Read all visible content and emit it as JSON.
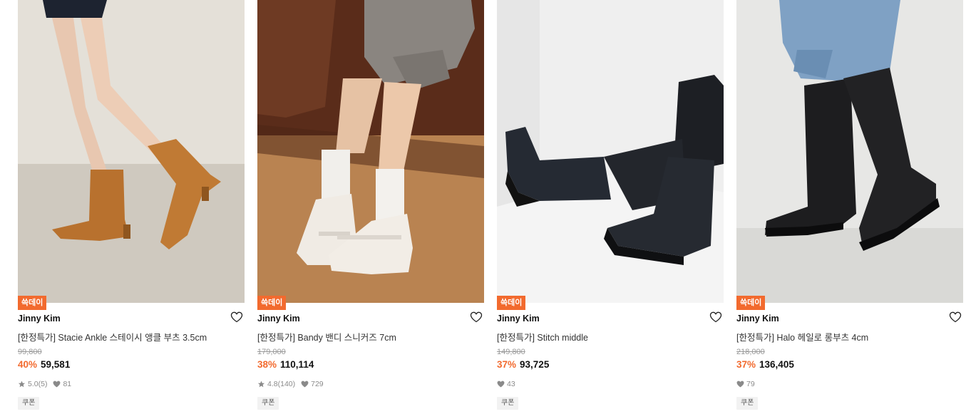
{
  "products": [
    {
      "badge": "쓱데이",
      "brand": "Jinny Kim",
      "name": "[한정특가] Stacie Ankle 스테이시 앵클 부츠 3.5cm",
      "original_price": "99,800",
      "discount": "40%",
      "price": "59,581",
      "rating": "5.0",
      "review_count": "(5)",
      "likes": "81",
      "coupon": "쿠폰",
      "photo_icon": "ankle-boot-photo"
    },
    {
      "badge": "쓱데이",
      "brand": "Jinny Kim",
      "name": "[한정특가] Bandy 밴디 스니커즈 7cm",
      "original_price": "179,000",
      "discount": "38%",
      "price": "110,114",
      "rating": "4.8",
      "review_count": "(140)",
      "likes": "729",
      "coupon": "쿠폰",
      "photo_icon": "sneaker-photo"
    },
    {
      "badge": "쓱데이",
      "brand": "Jinny Kim",
      "name": "[한정특가] Stitch middle",
      "original_price": "149,800",
      "discount": "37%",
      "price": "93,725",
      "likes": "43",
      "coupon": "쿠폰",
      "photo_icon": "middle-boot-photo"
    },
    {
      "badge": "쓱데이",
      "brand": "Jinny Kim",
      "name": "[한정특가] Halo 헤일로 롱부츠 4cm",
      "original_price": "218,000",
      "discount": "37%",
      "price": "136,405",
      "likes": "79",
      "coupon": "쿠폰",
      "photo_icon": "long-boot-photo"
    }
  ],
  "colors": {
    "accent": "#f26a2e",
    "text": "#111111",
    "muted": "#9a9a9a"
  }
}
